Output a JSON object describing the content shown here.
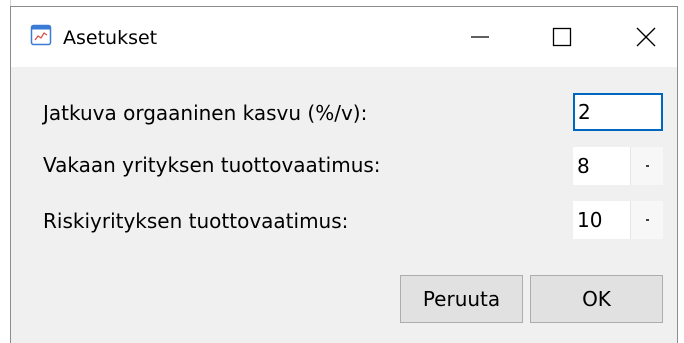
{
  "window": {
    "title": "Asetukset",
    "icon": "chart-app-icon",
    "controls": {
      "minimize": "minimize-icon",
      "maximize": "maximize-icon",
      "close": "close-icon"
    }
  },
  "fields": [
    {
      "label": "Jatkuva orgaaninen kasvu (%/v):",
      "value": "2",
      "type": "text"
    },
    {
      "label": "Vakaan yrityksen tuottovaatimus:",
      "value": "8",
      "type": "spin"
    },
    {
      "label": "Riskiyrityksen tuottovaatimus:",
      "value": "10",
      "type": "spin"
    }
  ],
  "buttons": {
    "cancel": "Peruuta",
    "ok": "OK"
  },
  "colors": {
    "focus_border": "#0067c0",
    "dialog_bg": "#f0f0f0",
    "button_bg": "#e1e1e1"
  }
}
